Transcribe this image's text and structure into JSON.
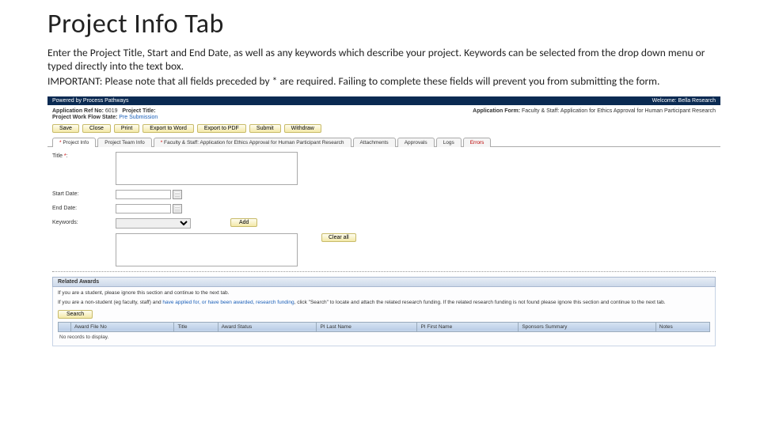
{
  "heading": "Project Info Tab",
  "para1": "Enter the Project Title, Start and End Date, as well as any keywords which describe your project. Keywords can be selected from the drop down menu or typed directly into the text box.",
  "para2": "IMPORTANT: Please note that all fields preceded by * are required. Failing to complete these fields will prevent you from submitting the form.",
  "topbar": {
    "left": "Powered by Process Pathways",
    "right": "Welcome: Bella Research"
  },
  "meta": {
    "ref_label": "Application Ref No:",
    "ref_val": "6019",
    "title_label": "Project Title:",
    "wf_label": "Project Work Flow State:",
    "wf_val": "Pre Submission",
    "form_label": "Application Form:",
    "form_val": "Faculty & Staff: Application for Ethics Approval for Human Participant Research"
  },
  "buttons": {
    "save": "Save",
    "close": "Close",
    "print": "Print",
    "word": "Export to Word",
    "pdf": "Export to PDF",
    "submit": "Submit",
    "withdraw": "Withdraw"
  },
  "tabs": {
    "t1": "Project Info",
    "t2": "Project Team Info",
    "t3": "Faculty & Staff: Application for Ethics Approval for Human Participant Research",
    "t4": "Attachments",
    "t5": "Approvals",
    "t6": "Logs",
    "t7": "Errors"
  },
  "form": {
    "title_label": "Title",
    "start_label": "Start Date:",
    "end_label": "End Date:",
    "kw_label": "Keywords:",
    "add": "Add",
    "clear": "Clear all"
  },
  "awards": {
    "header": "Related Awards",
    "hint1": "If you are a student, please ignore this section and continue to the next tab.",
    "hint2a": "If you are a non-student (eg faculty, staff) and ",
    "hint2_blue": "have applied for, or have been awarded, research funding",
    "hint2b": ", click \"Search\" to locate and attach the related research funding. If the related research funding is not found please ignore this section and continue to the next tab.",
    "search": "Search",
    "cols": {
      "c1": "Award File No",
      "c2": "Title",
      "c3": "Award Status",
      "c4": "PI Last Name",
      "c5": "PI First Name",
      "c6": "Sponsors Summary",
      "c7": "Notes"
    },
    "empty": "No records to display."
  }
}
